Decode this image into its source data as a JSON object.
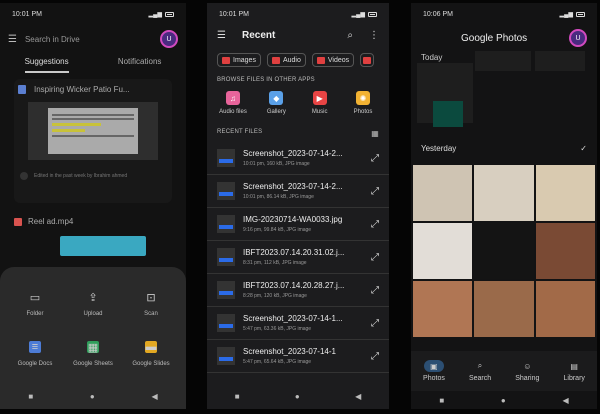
{
  "drive": {
    "time": "10:01 PM",
    "search_placeholder": "Search in Drive",
    "avatar": "U",
    "tabs": [
      "Suggestions",
      "Notifications"
    ],
    "doc_title": "Inspiring Wicker Patio Fu...",
    "edited": "Edited in the past week by Ibrahim ahmed",
    "reel": "Reel ad.mp4",
    "sheet": [
      {
        "label": "Folder",
        "icon": "▭"
      },
      {
        "label": "Upload",
        "icon": "⇪"
      },
      {
        "label": "Scan",
        "icon": "⊡"
      },
      {
        "label": "Google Docs",
        "icon": "≡"
      },
      {
        "label": "Google Sheets",
        "icon": "▦"
      },
      {
        "label": "Google Slides",
        "icon": "▬"
      }
    ]
  },
  "files": {
    "time": "10:01 PM",
    "title": "Recent",
    "chips": [
      "Images",
      "Audio",
      "Videos"
    ],
    "browse_header": "BROWSE FILES IN OTHER APPS",
    "apps": [
      {
        "label": "Audio files",
        "color": "#e8649b",
        "icon": "♫"
      },
      {
        "label": "Gallery",
        "color": "#5aa0e8",
        "icon": "◆"
      },
      {
        "label": "Music",
        "color": "#e84444",
        "icon": "▶"
      },
      {
        "label": "Photos",
        "color": "#f2b233",
        "icon": "✺"
      }
    ],
    "recent_header": "RECENT FILES",
    "items": [
      {
        "name": "Screenshot_2023-07-14-2...",
        "sub": "10:01 pm, 160 kB, JPG image"
      },
      {
        "name": "Screenshot_2023-07-14-2...",
        "sub": "10:01 pm, 86.14 kB, JPG image"
      },
      {
        "name": "IMG-20230714-WA0033.jpg",
        "sub": "9:16 pm, 99.84 kB, JPG image"
      },
      {
        "name": "IBFT2023.07.14.20.31.02.j...",
        "sub": "8:31 pm, 112 kB, JPG image"
      },
      {
        "name": "IBFT2023.07.14.20.28.27.j...",
        "sub": "8:28 pm, 120 kB, JPG image"
      },
      {
        "name": "Screenshot_2023-07-14-1...",
        "sub": "5:47 pm, 63.36 kB, JPG image"
      },
      {
        "name": "Screenshot_2023-07-14-1",
        "sub": "5:47 pm, 65.64 kB, JPG image"
      }
    ]
  },
  "photos": {
    "time": "10:06 PM",
    "title": "Google Photos",
    "avatar": "U",
    "today": "Today",
    "yesterday": "Yesterday",
    "grid_colors": [
      "#cfc4b3",
      "#d8cfc0",
      "#d9cab0",
      "#e2ddd7",
      "#141414",
      "#7a4a34",
      "#b07654",
      "#9a6a4a",
      "#a26a48"
    ],
    "tabs": [
      "Photos",
      "Search",
      "Sharing",
      "Library"
    ]
  }
}
